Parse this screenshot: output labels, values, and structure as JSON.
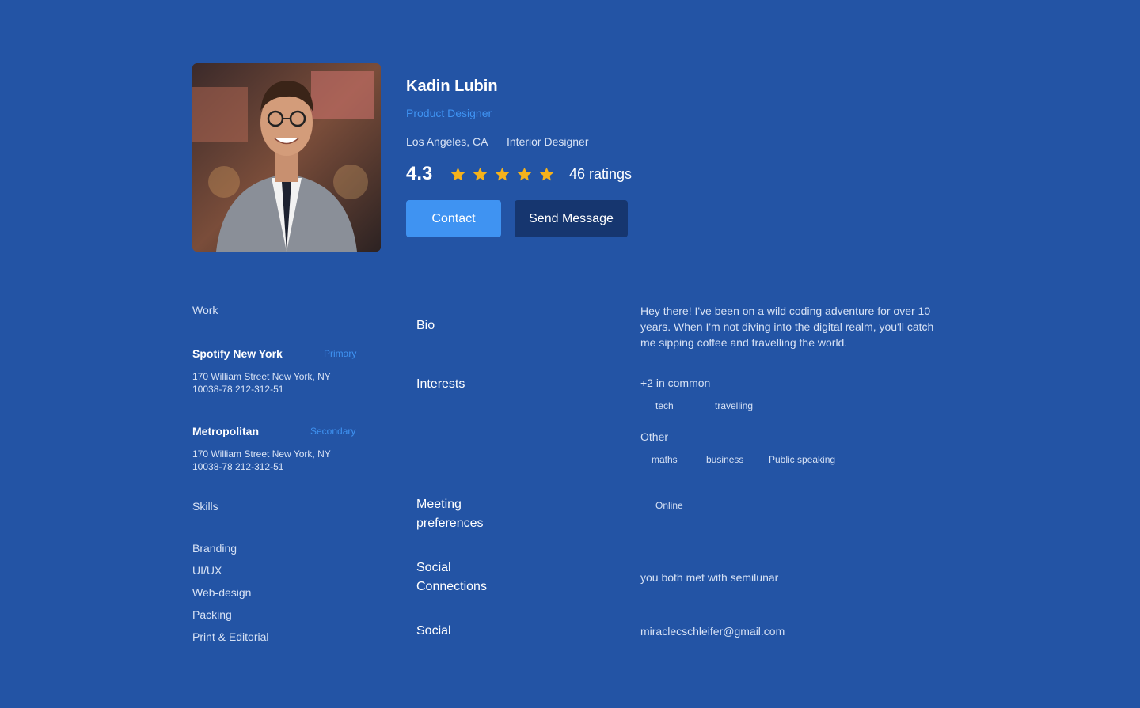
{
  "profile": {
    "name": "Kadin Lubin",
    "role": "Product Designer",
    "location": "Los Angeles, CA",
    "job": "Interior Designer",
    "rating": "4.3",
    "stars": 5,
    "ratings_count": "46 ratings",
    "contact_label": "Contact",
    "send_message_label": "Send Message"
  },
  "work": {
    "label": "Work",
    "companies": [
      {
        "name": "Spotify New York",
        "badge": "Primary",
        "address": "170 William Street New York, NY 10038-78 212-312-51"
      },
      {
        "name": "Metropolitan",
        "badge": "Secondary",
        "address": "170 William Street New York, NY 10038-78 212-312-51"
      }
    ]
  },
  "skills": {
    "label": "Skills",
    "items": [
      "Branding",
      "UI/UX",
      "Web-design",
      "Packing",
      "Print & Editorial"
    ]
  },
  "details": {
    "bio_label": "Bio",
    "bio_text": "Hey there! I've been on a wild coding adventure for over 10 years. When I'm not diving into the digital realm, you'll catch me sipping coffee and travelling the world.",
    "interests_label": "Interests",
    "common_label": "+2 in common",
    "common_tags": [
      "tech",
      "travelling"
    ],
    "other_label": "Other",
    "other_tags": [
      "maths",
      "business",
      "Public speaking"
    ],
    "meeting_label": "Meeting preferences",
    "meeting_value": "Online",
    "connections_label": "Social Connections",
    "connections_value": "you both met with semilunar",
    "social_label": "Social",
    "social_value": "miraclecschleifer@gmail.com"
  },
  "colors": {
    "background": "#2354A5",
    "accent": "#3F93F2",
    "dark_button": "#16366F",
    "star": "#F5B21B"
  }
}
